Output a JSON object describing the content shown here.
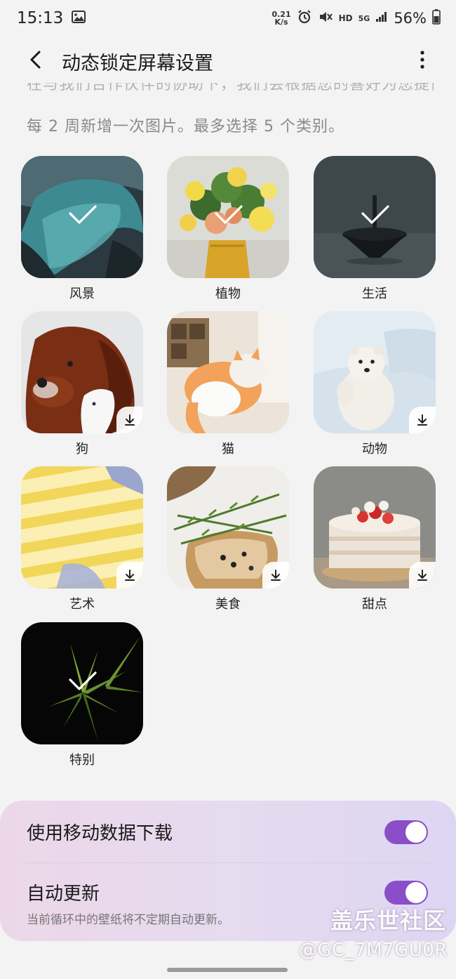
{
  "status": {
    "time": "15:13",
    "net_speed_value": "0.21",
    "net_speed_unit": "K/s",
    "hd": "HD",
    "network": "5G",
    "battery": "56%"
  },
  "appbar": {
    "title": "动态锁定屏幕设置"
  },
  "description": {
    "cut_line": "在与我们合作伙伴的协助下，我们会根据您的喜好为您提供全新",
    "line": "每 2 周新增一次图片。最多选择 5 个类别。"
  },
  "categories": [
    {
      "label": "风景",
      "selected": true,
      "download": false
    },
    {
      "label": "植物",
      "selected": true,
      "download": false
    },
    {
      "label": "生活",
      "selected": true,
      "download": false
    },
    {
      "label": "狗",
      "selected": false,
      "download": true
    },
    {
      "label": "猫",
      "selected": false,
      "download": false
    },
    {
      "label": "动物",
      "selected": false,
      "download": true
    },
    {
      "label": "艺术",
      "selected": false,
      "download": true
    },
    {
      "label": "美食",
      "selected": false,
      "download": true
    },
    {
      "label": "甜点",
      "selected": false,
      "download": true
    },
    {
      "label": "特别",
      "selected": true,
      "download": false
    }
  ],
  "settings": {
    "mobile_data": {
      "title": "使用移动数据下载",
      "on": true
    },
    "auto_update": {
      "title": "自动更新",
      "subtitle": "当前循环中的壁纸将不定期自动更新。",
      "on": true
    }
  },
  "watermark": {
    "line1": "盖乐世社区",
    "line2": "@GC_7M7GU0R"
  },
  "colors": {
    "accent": "#8a4fc8",
    "background": "#f3f3f3"
  }
}
